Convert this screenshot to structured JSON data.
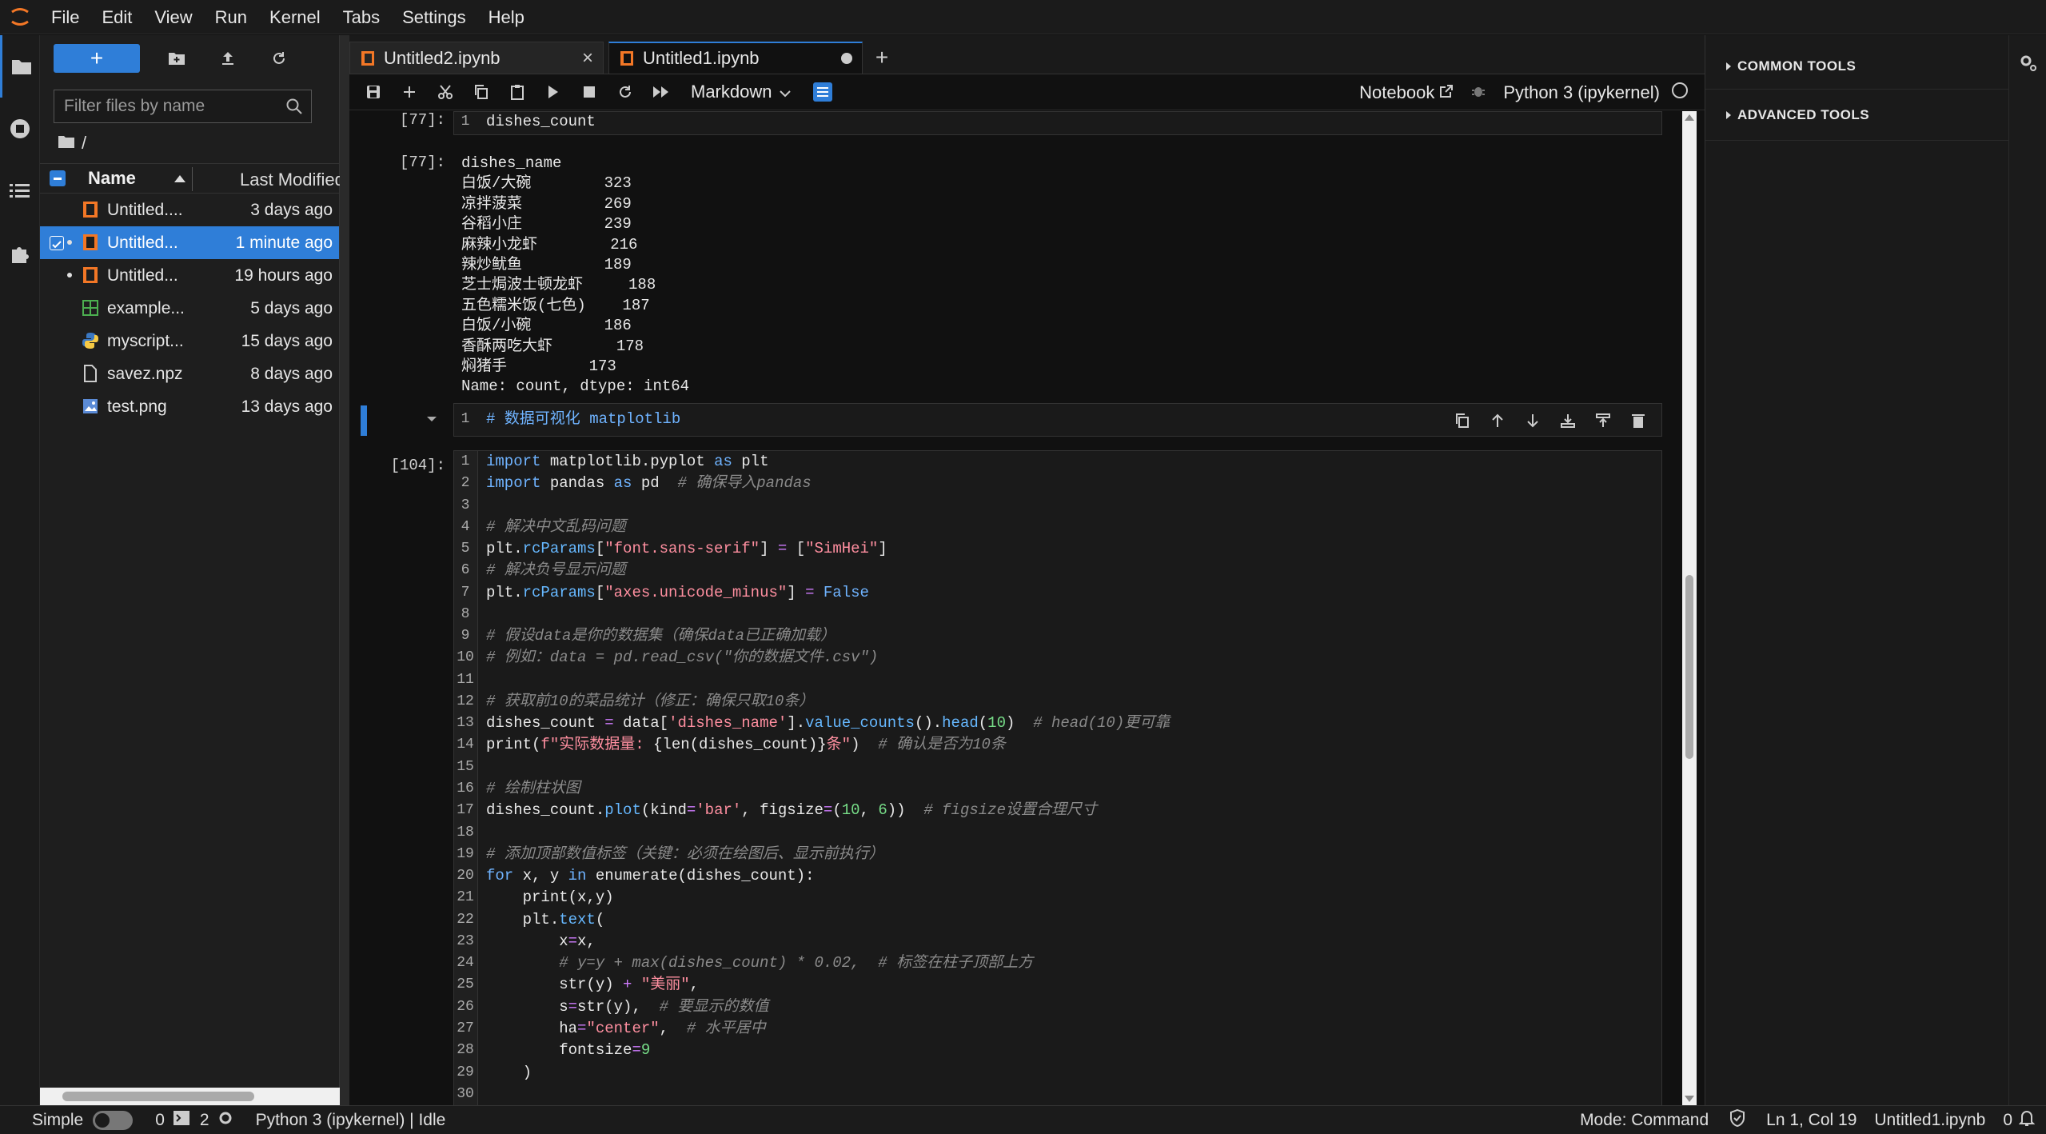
{
  "menu": [
    "File",
    "Edit",
    "View",
    "Run",
    "Kernel",
    "Tabs",
    "Settings",
    "Help"
  ],
  "filebrowser": {
    "filter_placeholder": "Filter files by name",
    "path": "/",
    "col_name": "Name",
    "col_modified": "Last Modified",
    "files": [
      {
        "name": "Untitled....",
        "modified": "3 days ago",
        "type": "notebook",
        "selected": false,
        "running": false
      },
      {
        "name": "Untitled...",
        "modified": "1 minute ago",
        "type": "notebook",
        "selected": true,
        "running": true
      },
      {
        "name": "Untitled...",
        "modified": "19 hours ago",
        "type": "notebook",
        "selected": false,
        "running": true
      },
      {
        "name": "example...",
        "modified": "5 days ago",
        "type": "csv",
        "selected": false,
        "running": false
      },
      {
        "name": "myscript...",
        "modified": "15 days ago",
        "type": "python",
        "selected": false,
        "running": false
      },
      {
        "name": "savez.npz",
        "modified": "8 days ago",
        "type": "file",
        "selected": false,
        "running": false
      },
      {
        "name": "test.png",
        "modified": "13 days ago",
        "type": "image",
        "selected": false,
        "running": false
      }
    ]
  },
  "tabs": [
    {
      "label": "Untitled2.ipynb",
      "active": false
    },
    {
      "label": "Untitled1.ipynb",
      "active": true
    }
  ],
  "toolbar": {
    "cell_type": "Markdown",
    "notebook_label": "Notebook",
    "kernel_label": "Python 3 (ipykernel)"
  },
  "cells": {
    "cell77_prompt_in": "[77]:",
    "cell77_code": "dishes_count",
    "cell77_prompt_out": "[77]:",
    "cell77_output": [
      "dishes_name",
      "白饭/大碗        323",
      "凉拌菠菜         269",
      "谷稻小庄         239",
      "麻辣小龙虾        216",
      "辣炒鱿鱼         189",
      "芝士焗波士顿龙虾     188",
      "五色糯米饭(七色)    187",
      "白饭/小碗        186",
      "香酥两吃大虾       178",
      "焖猪手         173",
      "Name: count, dtype: int64"
    ],
    "md_line": "# 数据可视化 matplotlib",
    "cell104_prompt": "[104]:"
  },
  "rightpanel": {
    "sections": [
      "COMMON TOOLS",
      "ADVANCED TOOLS"
    ]
  },
  "status": {
    "mode_label": "Simple",
    "terminals": "0",
    "kernels": "2",
    "kernel_status": "Python 3 (ipykernel) | Idle",
    "mode": "Mode: Command",
    "cursor": "Ln 1, Col 19",
    "filename": "Untitled1.ipynb",
    "notifications": "0"
  },
  "colors": {
    "accent": "#2f7ed8",
    "orange": "#f37726"
  }
}
